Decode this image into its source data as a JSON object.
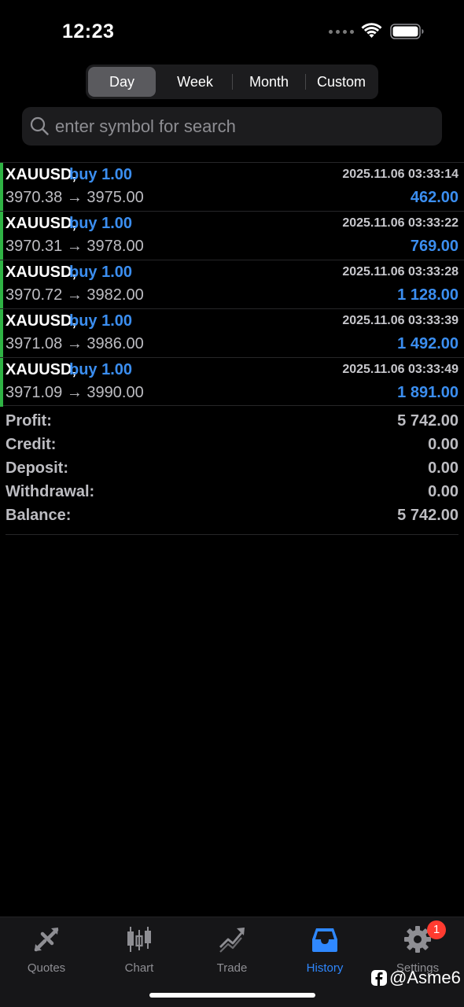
{
  "status_bar": {
    "time": "12:23",
    "icons": [
      "signal-dots-icon",
      "wifi-icon",
      "battery-icon"
    ]
  },
  "period_tabs": {
    "items": [
      "Day",
      "Week",
      "Month",
      "Custom"
    ],
    "selected": "Day"
  },
  "search": {
    "placeholder": "enter symbol for search",
    "value": ""
  },
  "trades": [
    {
      "symbol": "XAUUSD,",
      "type": "buy 1.00",
      "time": "2025.11.06 03:33:14",
      "open_price": "3970.38",
      "arrow": "→",
      "close_price": "3975.00",
      "profit": "462.00"
    },
    {
      "symbol": "XAUUSD,",
      "type": "buy 1.00",
      "time": "2025.11.06 03:33:22",
      "open_price": "3970.31",
      "arrow": "→",
      "close_price": "3978.00",
      "profit": "769.00"
    },
    {
      "symbol": "XAUUSD,",
      "type": "buy 1.00",
      "time": "2025.11.06 03:33:28",
      "open_price": "3970.72",
      "arrow": "→",
      "close_price": "3982.00",
      "profit": "1 128.00"
    },
    {
      "symbol": "XAUUSD,",
      "type": "buy 1.00",
      "time": "2025.11.06 03:33:39",
      "open_price": "3971.08",
      "arrow": "→",
      "close_price": "3986.00",
      "profit": "1 492.00"
    },
    {
      "symbol": "XAUUSD,",
      "type": "buy 1.00",
      "time": "2025.11.06 03:33:49",
      "open_price": "3971.09",
      "arrow": "→",
      "close_price": "3990.00",
      "profit": "1 891.00"
    }
  ],
  "summary": {
    "profit": {
      "label": "Profit:",
      "value": "5 742.00"
    },
    "credit": {
      "label": "Credit:",
      "value": "0.00"
    },
    "deposit": {
      "label": "Deposit:",
      "value": "0.00"
    },
    "withdrawal": {
      "label": "Withdrawal:",
      "value": "0.00"
    },
    "balance": {
      "label": "Balance:",
      "value": "5 742.00"
    }
  },
  "tab_bar": {
    "items": [
      {
        "label": "Quotes",
        "icon": "quotes-icon"
      },
      {
        "label": "Chart",
        "icon": "chart-icon"
      },
      {
        "label": "Trade",
        "icon": "trade-icon"
      },
      {
        "label": "History",
        "icon": "history-icon"
      },
      {
        "label": "Settings",
        "icon": "settings-icon",
        "badge": "1"
      }
    ],
    "selected": "History"
  },
  "watermark": {
    "text": "@Asme6",
    "icon": "facebook-icon"
  },
  "colors": {
    "accent_blue": "#3b8ef0",
    "tab_active": "#2f88ff",
    "buy_bar_green": "#2fb344",
    "badge_red": "#ff3b30",
    "background": "#000000"
  }
}
